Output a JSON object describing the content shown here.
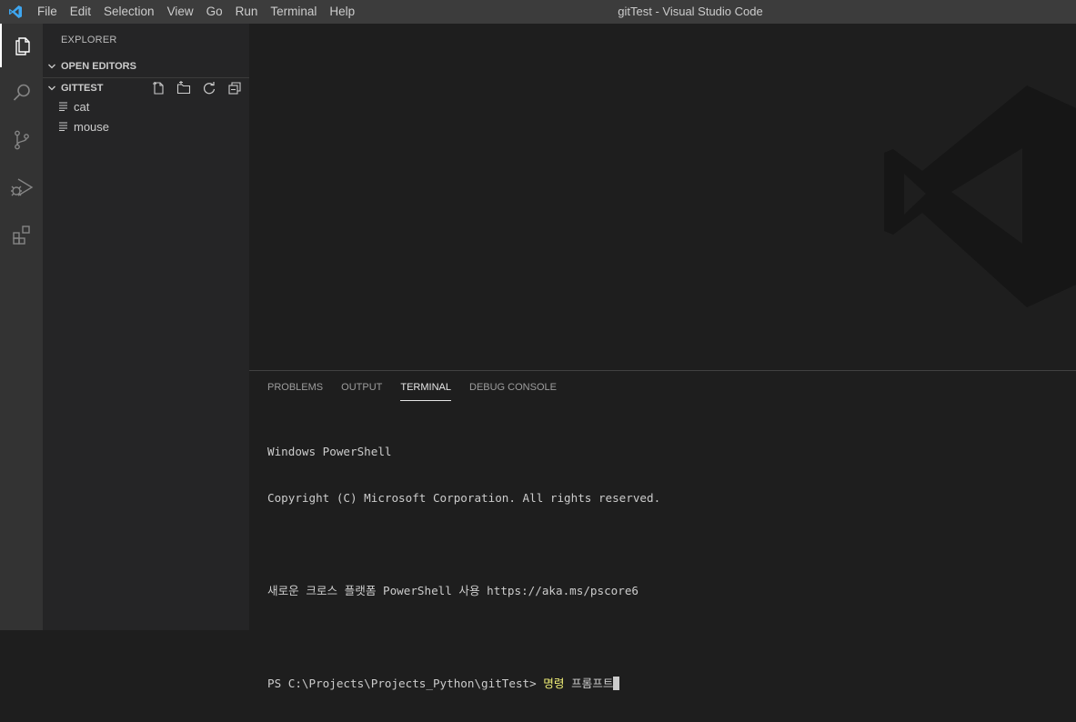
{
  "titlebar": {
    "menu": [
      "File",
      "Edit",
      "Selection",
      "View",
      "Go",
      "Run",
      "Terminal",
      "Help"
    ],
    "window_title": "gitTest - Visual Studio Code"
  },
  "activitybar": {
    "items": [
      "explorer-icon",
      "search-icon",
      "source-control-icon",
      "run-debug-icon",
      "extensions-icon"
    ],
    "active": "explorer-icon"
  },
  "sidebar": {
    "title": "EXPLORER",
    "open_editors": "OPEN EDITORS",
    "folder": "GITTEST",
    "files": [
      "cat",
      "mouse"
    ]
  },
  "panel": {
    "tabs": [
      "PROBLEMS",
      "OUTPUT",
      "TERMINAL",
      "DEBUG CONSOLE"
    ],
    "active_tab": "TERMINAL",
    "terminal": {
      "line1": "Windows PowerShell",
      "line2": "Copyright (C) Microsoft Corporation. All rights reserved.",
      "line3": "새로운 크로스 플랫폼 PowerShell 사용 https://aka.ms/pscore6",
      "prompt": "PS C:\\Projects\\Projects_Python\\gitTest> ",
      "command": "명령",
      "command_rest": " 프롬프트"
    }
  },
  "colors": {
    "accent": "#007acc",
    "titlebar": "#3c3c3c",
    "activitybar": "#333333",
    "sidebar": "#252526",
    "editor": "#1e1e1e"
  }
}
